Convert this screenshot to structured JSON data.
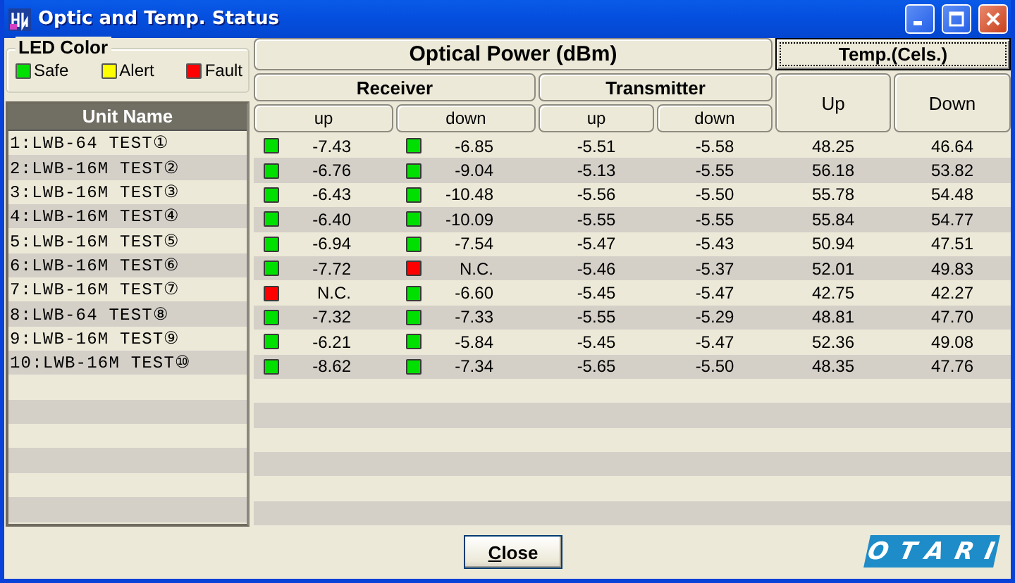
{
  "window": {
    "title": "Optic and Temp. Status"
  },
  "legend": {
    "title": "LED Color",
    "items": [
      {
        "label": "Safe",
        "color": "#00e000"
      },
      {
        "label": "Alert",
        "color": "#ffff00"
      },
      {
        "label": "Fault",
        "color": "#ff0000"
      }
    ]
  },
  "unit_list": {
    "header": "Unit Name",
    "units": [
      "1:LWB-64 TEST①",
      "2:LWB-16M TEST②",
      "3:LWB-16M TEST③",
      "4:LWB-16M TEST④",
      "5:LWB-16M TEST⑤",
      "6:LWB-16M TEST⑥",
      "7:LWB-16M TEST⑦",
      "8:LWB-64 TEST⑧",
      "9:LWB-16M TEST⑨",
      "10:LWB-16M TEST⑩"
    ]
  },
  "table": {
    "optical_header": "Optical Power (dBm)",
    "temp_header": "Temp.(Cels.)",
    "receiver_header": "Receiver",
    "transmitter_header": "Transmitter",
    "columns": [
      "up",
      "down",
      "up",
      "down",
      "Up",
      "Down"
    ],
    "rows": [
      {
        "rx_up": {
          "value": "-7.43",
          "color": "#00e000"
        },
        "rx_down": {
          "value": "-6.85",
          "color": "#00e000"
        },
        "tx_up": "-5.51",
        "tx_down": "-5.58",
        "temp_up": "48.25",
        "temp_down": "46.64"
      },
      {
        "rx_up": {
          "value": "-6.76",
          "color": "#00e000"
        },
        "rx_down": {
          "value": "-9.04",
          "color": "#00e000"
        },
        "tx_up": "-5.13",
        "tx_down": "-5.55",
        "temp_up": "56.18",
        "temp_down": "53.82"
      },
      {
        "rx_up": {
          "value": "-6.43",
          "color": "#00e000"
        },
        "rx_down": {
          "value": "-10.48",
          "color": "#00e000"
        },
        "tx_up": "-5.56",
        "tx_down": "-5.50",
        "temp_up": "55.78",
        "temp_down": "54.48"
      },
      {
        "rx_up": {
          "value": "-6.40",
          "color": "#00e000"
        },
        "rx_down": {
          "value": "-10.09",
          "color": "#00e000"
        },
        "tx_up": "-5.55",
        "tx_down": "-5.55",
        "temp_up": "55.84",
        "temp_down": "54.77"
      },
      {
        "rx_up": {
          "value": "-6.94",
          "color": "#00e000"
        },
        "rx_down": {
          "value": "-7.54",
          "color": "#00e000"
        },
        "tx_up": "-5.47",
        "tx_down": "-5.43",
        "temp_up": "50.94",
        "temp_down": "47.51"
      },
      {
        "rx_up": {
          "value": "-7.72",
          "color": "#00e000"
        },
        "rx_down": {
          "value": "N.C.",
          "color": "#ff0000"
        },
        "tx_up": "-5.46",
        "tx_down": "-5.37",
        "temp_up": "52.01",
        "temp_down": "49.83"
      },
      {
        "rx_up": {
          "value": "N.C.",
          "color": "#ff0000"
        },
        "rx_down": {
          "value": "-6.60",
          "color": "#00e000"
        },
        "tx_up": "-5.45",
        "tx_down": "-5.47",
        "temp_up": "42.75",
        "temp_down": "42.27"
      },
      {
        "rx_up": {
          "value": "-7.32",
          "color": "#00e000"
        },
        "rx_down": {
          "value": "-7.33",
          "color": "#00e000"
        },
        "tx_up": "-5.55",
        "tx_down": "-5.29",
        "temp_up": "48.81",
        "temp_down": "47.70"
      },
      {
        "rx_up": {
          "value": "-6.21",
          "color": "#00e000"
        },
        "rx_down": {
          "value": "-5.84",
          "color": "#00e000"
        },
        "tx_up": "-5.45",
        "tx_down": "-5.47",
        "temp_up": "52.36",
        "temp_down": "49.08"
      },
      {
        "rx_up": {
          "value": "-8.62",
          "color": "#00e000"
        },
        "rx_down": {
          "value": "-7.34",
          "color": "#00e000"
        },
        "tx_up": "-5.65",
        "tx_down": "-5.50",
        "temp_up": "48.35",
        "temp_down": "47.76"
      }
    ]
  },
  "close_button": {
    "label": "Close"
  },
  "logo": "OTARI"
}
